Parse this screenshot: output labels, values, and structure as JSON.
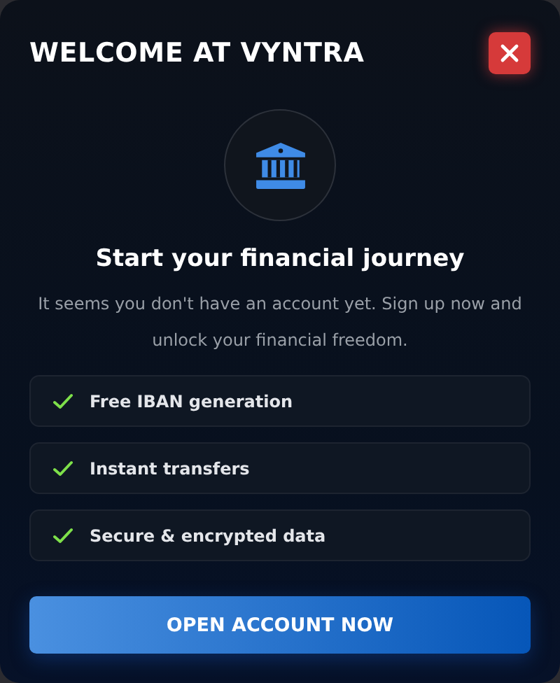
{
  "title": "WELCOME AT VYNTRA",
  "heading": "Start your financial journey",
  "description": "It seems you don't have an account yet. Sign up now and unlock your financial freedom.",
  "features": [
    {
      "label": "Free IBAN generation"
    },
    {
      "label": "Instant transfers"
    },
    {
      "label": "Secure & encrypted data"
    }
  ],
  "button": "OPEN ACCOUNT NOW"
}
